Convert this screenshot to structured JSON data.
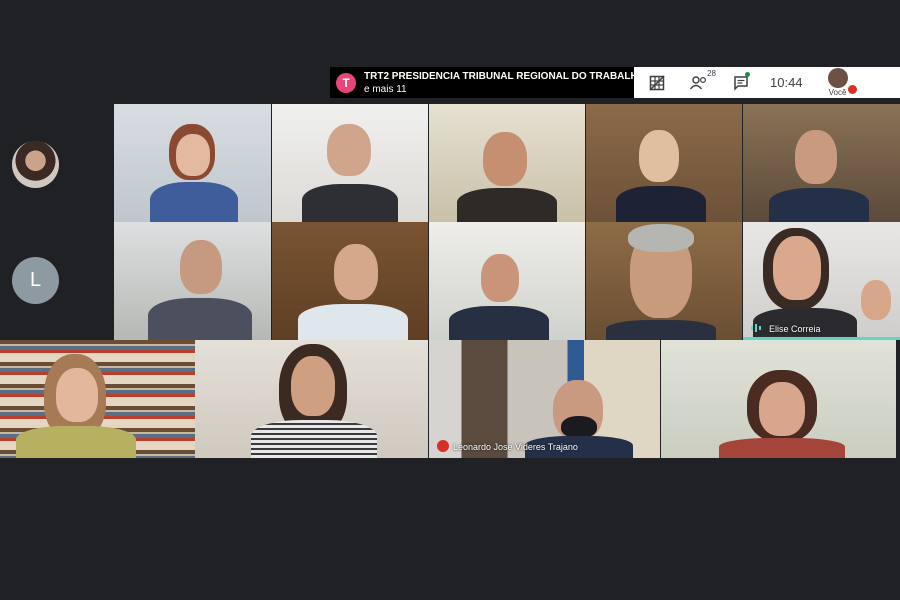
{
  "meeting": {
    "badge_letter": "T",
    "title": "TRT2 PRESIDENCIA TRIBUNAL REGIONAL DO TRABALH...",
    "subtitle": "e mais 11",
    "participant_count": "28",
    "time": "10:44",
    "you_label": "Você"
  },
  "sidebar": {
    "avatar_letter": "L"
  },
  "tiles": {
    "speaker_name": "Elise Correia",
    "leonardo_name": "Leonardo Jose Videres Trajano"
  },
  "colors": {
    "speaking": "#5ed6c6",
    "badge": "#e8457a",
    "mic_off": "#d93025"
  }
}
